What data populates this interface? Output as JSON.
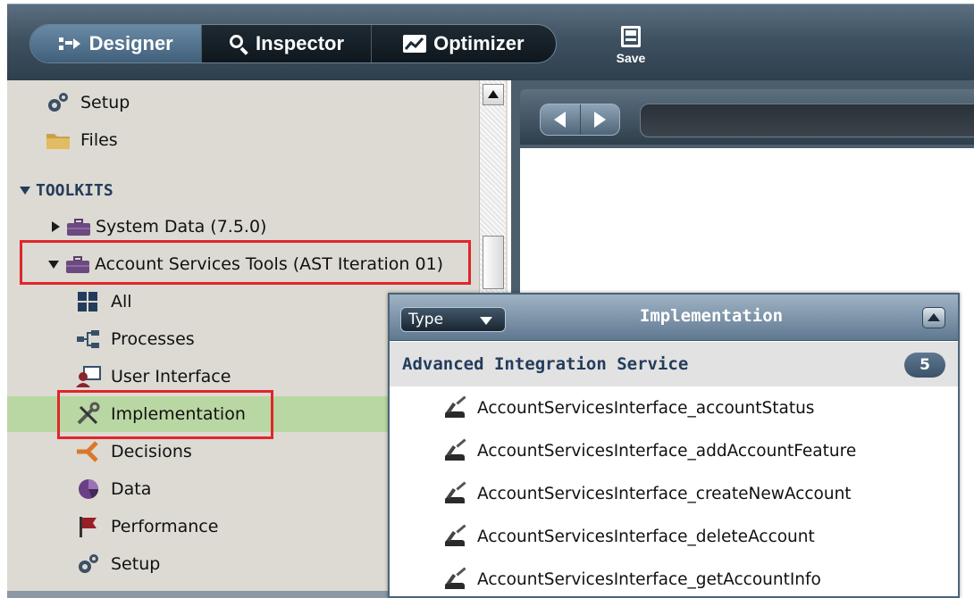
{
  "toolbar": {
    "tabs": [
      {
        "label": "Designer",
        "icon": "designer-icon",
        "active": true
      },
      {
        "label": "Inspector",
        "icon": "search-icon",
        "active": false
      },
      {
        "label": "Optimizer",
        "icon": "chart-icon",
        "active": false
      }
    ],
    "save_label": "Save"
  },
  "library": {
    "top_items": [
      {
        "label": "Setup",
        "icon": "gears-icon"
      },
      {
        "label": "Files",
        "icon": "folder-icon"
      }
    ],
    "toolkits_heading": "TOOLKITS",
    "toolkits": [
      {
        "label": "System Data (7.5.0)",
        "expanded": false
      },
      {
        "label": "Account Services Tools (AST Iteration 01)",
        "expanded": true
      }
    ],
    "categories": [
      {
        "label": "All",
        "icon": "grid-icon"
      },
      {
        "label": "Processes",
        "icon": "process-icon"
      },
      {
        "label": "User Interface",
        "icon": "user-interface-icon"
      },
      {
        "label": "Implementation",
        "icon": "tools-icon",
        "selected": true
      },
      {
        "label": "Decisions",
        "icon": "decision-icon"
      },
      {
        "label": "Data",
        "icon": "data-icon"
      },
      {
        "label": "Performance",
        "icon": "flag-icon"
      },
      {
        "label": "Setup",
        "icon": "gears-icon"
      }
    ]
  },
  "popup": {
    "filter_label": "Type",
    "title": "Implementation",
    "group": {
      "title": "Advanced Integration Service",
      "count": "5",
      "items": [
        "AccountServicesInterface_accountStatus",
        "AccountServicesInterface_addAccountFeature",
        "AccountServicesInterface_createNewAccount",
        "AccountServicesInterface_deleteAccount",
        "AccountServicesInterface_getAccountInfo"
      ]
    }
  },
  "colors": {
    "highlight_box": "#e0262b",
    "selected_row": "#b9d7a2",
    "section_heading": "#243c5c"
  }
}
